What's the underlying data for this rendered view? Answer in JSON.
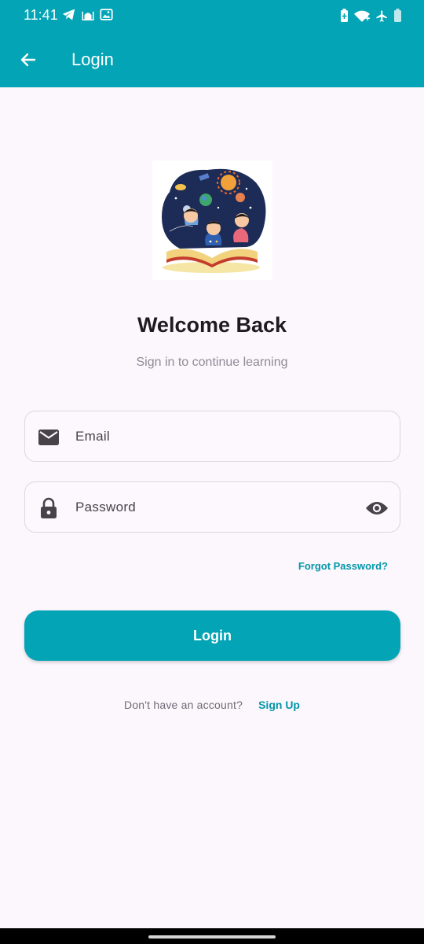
{
  "status_bar": {
    "time": "11:41",
    "left_icons": [
      "telegram-icon",
      "mosque-icon",
      "image-icon"
    ],
    "right_icons": [
      "battery-saver-icon",
      "wifi-icon",
      "airplane-icon",
      "battery-icon"
    ]
  },
  "app_bar": {
    "back_icon": "arrow-back-icon",
    "title": "Login"
  },
  "header": {
    "welcome": "Welcome Back",
    "subtitle": "Sign in to continue learning"
  },
  "form": {
    "email": {
      "placeholder": "Email",
      "icon": "mail-icon"
    },
    "password": {
      "placeholder": "Password",
      "icon": "lock-icon",
      "toggle_icon": "eye-icon"
    },
    "forgot_password": "Forgot Password?",
    "login_button": "Login"
  },
  "footer": {
    "prompt": "Don't have an account?",
    "signup_link": "Sign Up"
  },
  "colors": {
    "primary": "#03a4b5",
    "background": "#fcf6fd",
    "text_dark": "#1d1b20",
    "link": "#0397a8"
  }
}
